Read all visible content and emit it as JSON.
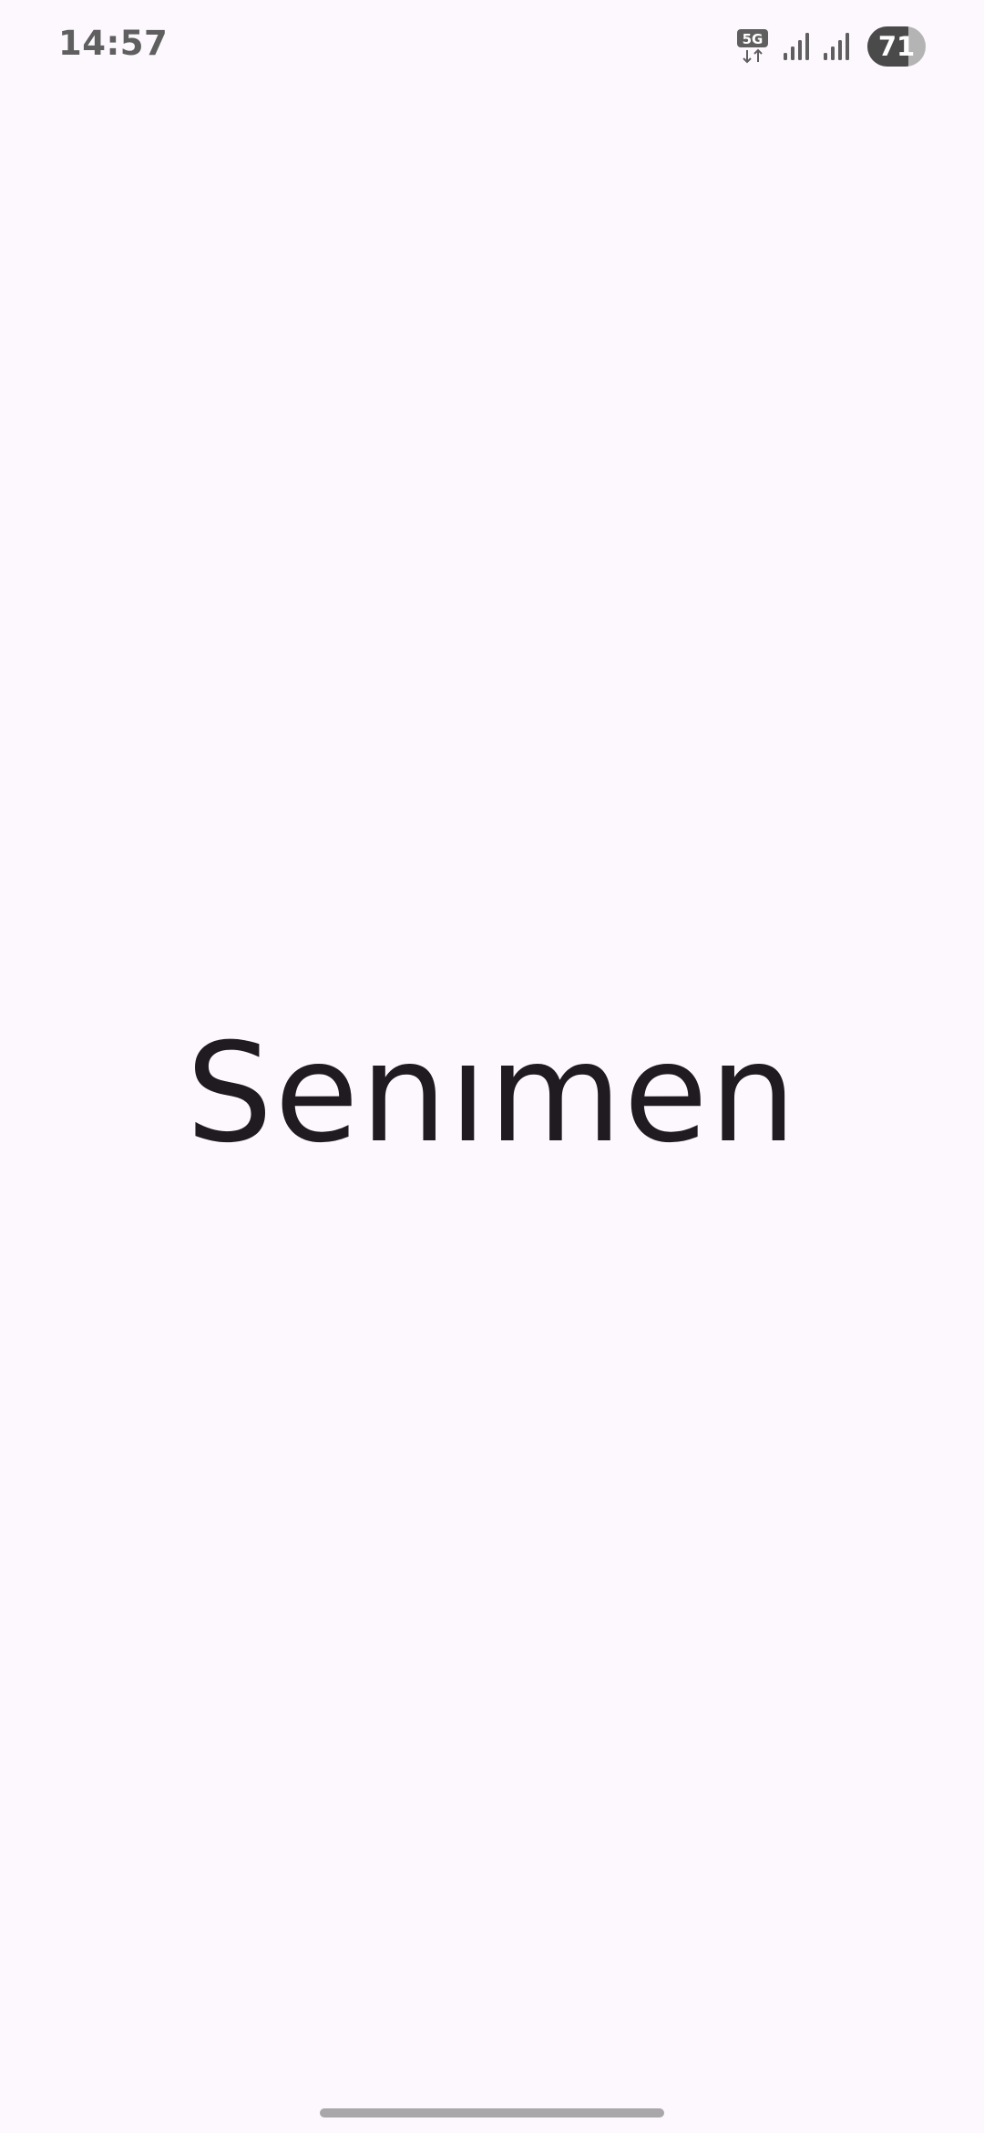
{
  "status_bar": {
    "time": "14:57",
    "network": "5G",
    "battery": "71",
    "battery_level": 0.71
  },
  "app": {
    "name": "Senımen"
  },
  "colors": {
    "background": "#fdf8fd",
    "wordmark": "#1f1b21",
    "status_text": "#5f5f5f",
    "home_indicator": "#a9a7aa"
  }
}
